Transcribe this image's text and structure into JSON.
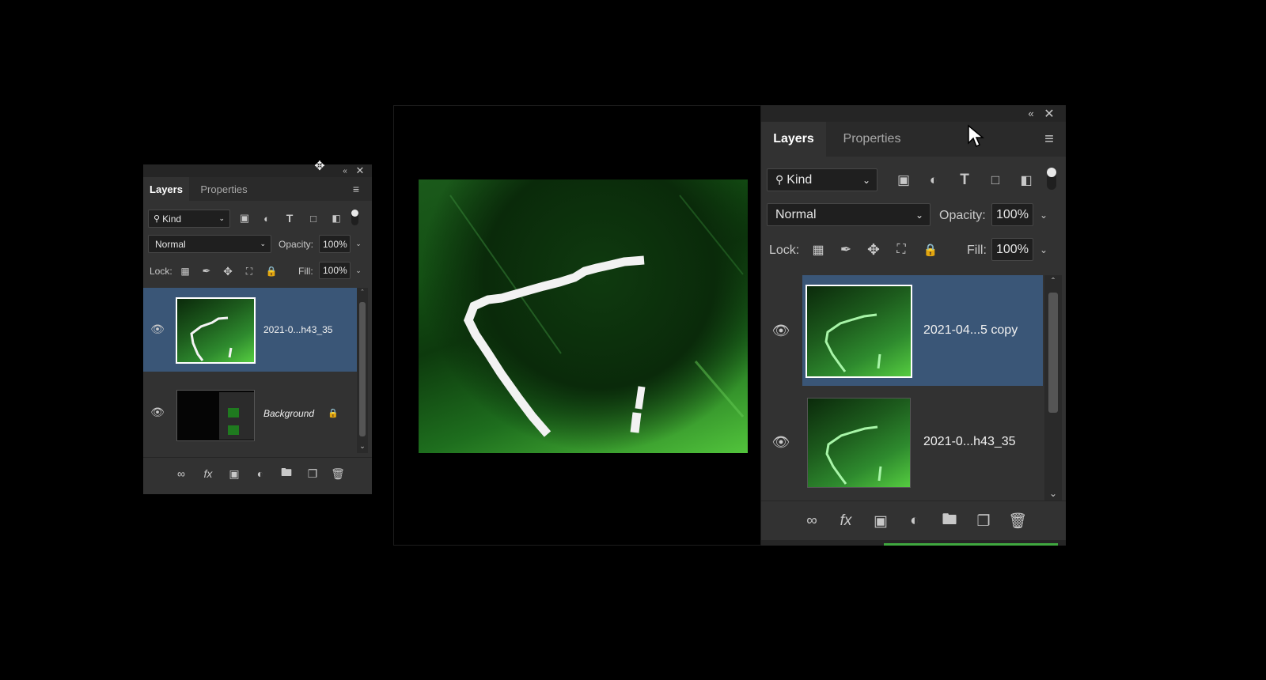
{
  "small_panel": {
    "tabs": [
      "Layers",
      "Properties"
    ],
    "filter_kind": "Kind",
    "blend_mode": "Normal",
    "opacity_label": "Opacity:",
    "opacity_value": "100%",
    "lock_label": "Lock:",
    "fill_label": "Fill:",
    "fill_value": "100%",
    "layers": [
      {
        "name": "2021-0...h43_35",
        "selected": true
      },
      {
        "name": "Background",
        "selected": false,
        "locked": true
      }
    ]
  },
  "large_panel": {
    "tabs": [
      "Layers",
      "Properties"
    ],
    "filter_kind": "Kind",
    "blend_mode": "Normal",
    "opacity_label": "Opacity:",
    "opacity_value": "100%",
    "lock_label": "Lock:",
    "fill_label": "Fill:",
    "fill_value": "100%",
    "layers": [
      {
        "name": "2021-04...5 copy",
        "selected": true
      },
      {
        "name": "2021-0...h43_35",
        "selected": false
      }
    ]
  },
  "icons": {
    "filter": [
      "image-filter-icon",
      "adjustment-filter-icon",
      "type-filter-icon",
      "shape-filter-icon",
      "smart-object-filter-icon",
      "filter-toggle-icon"
    ],
    "lock": [
      "lock-transparent-icon",
      "lock-pixels-icon",
      "lock-position-icon",
      "lock-artboard-icon",
      "lock-all-icon"
    ],
    "footer": [
      "link-layers-icon",
      "fx-icon",
      "layer-mask-icon",
      "adjustment-layer-icon",
      "group-icon",
      "new-layer-icon",
      "delete-icon"
    ]
  },
  "colors": {
    "panel_bg": "#323232",
    "selected_row": "#3a5677",
    "canvas_bg": "#000000"
  }
}
